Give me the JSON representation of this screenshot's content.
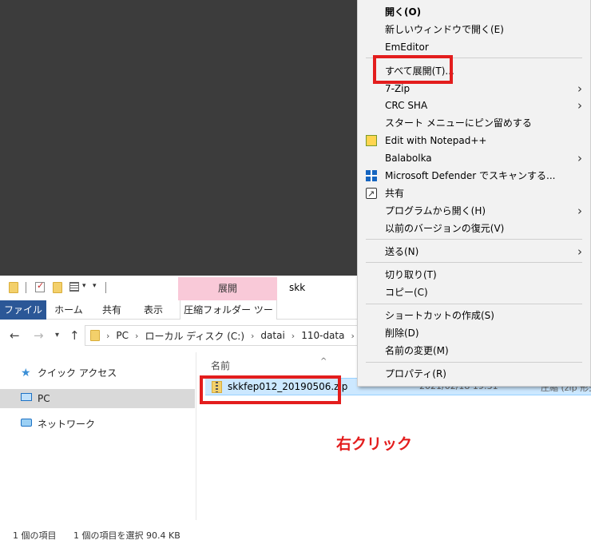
{
  "explorer": {
    "window_title": "skk",
    "quick_access_toolbar": {
      "icons": [
        "folder-icon",
        "properties-icon",
        "new-folder-icon",
        "view-icon",
        "customize-dropdown-icon"
      ]
    },
    "contextual_tab_group": "展開",
    "ribbon_tabs": {
      "file": "ファイル",
      "home": "ホーム",
      "share": "共有",
      "view": "表示",
      "compressed_tools": "圧縮フォルダー ツール"
    },
    "address": {
      "breadcrumbs": [
        "PC",
        "ローカル ディスク (C:)",
        "datai",
        "110-data",
        "skk"
      ]
    },
    "nav_pane": {
      "items": [
        {
          "label": "クイック アクセス",
          "icon": "star-icon",
          "selected": false
        },
        {
          "label": "PC",
          "icon": "pc-icon",
          "selected": true
        },
        {
          "label": "ネットワーク",
          "icon": "network-icon",
          "selected": false
        }
      ]
    },
    "columns": {
      "name": "名前"
    },
    "files": [
      {
        "name": "skkfep012_20190506.zip",
        "date": "2021/02/18 19:31",
        "type": "圧縮 (zip 形式"
      }
    ],
    "status": {
      "item_count": "1 個の項目",
      "selection": "1 個の項目を選択  90.4 KB"
    }
  },
  "annotation": "右クリック",
  "highlight_color": "#e31d1d",
  "context_menu": {
    "items": [
      {
        "label": "開く(O)",
        "bold": true
      },
      {
        "label": "新しいウィンドウで開く(E)"
      },
      {
        "label": "EmEditor"
      },
      {
        "label": "すべて展開(T)..."
      },
      {
        "label": "7-Zip",
        "submenu": true
      },
      {
        "label": "CRC SHA",
        "submenu": true
      },
      {
        "label": "スタート メニューにピン留めする"
      },
      {
        "label": "Edit with Notepad++",
        "icon": "notepad-plus-plus-icon"
      },
      {
        "label": "Balabolka",
        "submenu": true
      },
      {
        "label": "Microsoft Defender でスキャンする...",
        "icon": "defender-icon"
      },
      {
        "label": "共有",
        "icon": "share-icon"
      },
      {
        "label": "プログラムから開く(H)",
        "submenu": true
      },
      {
        "label": "以前のバージョンの復元(V)"
      },
      {
        "label": "送る(N)",
        "submenu": true
      },
      {
        "label": "切り取り(T)"
      },
      {
        "label": "コピー(C)"
      },
      {
        "label": "ショートカットの作成(S)"
      },
      {
        "label": "削除(D)"
      },
      {
        "label": "名前の変更(M)"
      },
      {
        "label": "プロパティ(R)"
      }
    ]
  }
}
